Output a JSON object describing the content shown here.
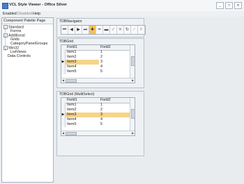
{
  "window": {
    "title": "VCL Style Viewer - Office Silver"
  },
  "menu": {
    "items": [
      {
        "label": "Enabled",
        "enabled": true
      },
      {
        "label": "Disabled",
        "enabled": false
      },
      {
        "label": "Help",
        "enabled": true
      }
    ]
  },
  "left_panel": {
    "caption": "Component Palette Page",
    "tree": [
      {
        "label": "Standard",
        "expander": "-"
      },
      {
        "label": "Forms"
      },
      {
        "label": "Additional",
        "expander": "-"
      },
      {
        "label": "Grids"
      },
      {
        "label": "CategoryPanelGroups"
      },
      {
        "label": "Win32",
        "expander": "-"
      },
      {
        "label": "ListViews"
      },
      {
        "label": "Data Controls"
      }
    ]
  },
  "navigator": {
    "caption": "TDBNavigator",
    "buttons": [
      {
        "icon": "first-record-icon",
        "glyph": "⏮"
      },
      {
        "icon": "prior-record-icon",
        "glyph": "◀"
      },
      {
        "icon": "next-record-icon",
        "glyph": "▶"
      },
      {
        "icon": "last-record-icon",
        "glyph": "⏭"
      },
      {
        "icon": "insert-icon",
        "glyph": "✚"
      },
      {
        "icon": "delete-icon",
        "glyph": "━"
      },
      {
        "icon": "edit-icon",
        "glyph": "▬"
      },
      {
        "icon": "post-icon",
        "glyph": "✔"
      },
      {
        "icon": "cancel-icon",
        "glyph": "✖"
      },
      {
        "icon": "refresh-icon",
        "glyph": "↻"
      },
      {
        "icon": "apply-updates-icon",
        "glyph": "✓"
      },
      {
        "icon": "cancel-updates-icon",
        "glyph": "✗"
      }
    ]
  },
  "grid1": {
    "caption": "TDBGrid",
    "columns": [
      "Field1",
      "Field2"
    ],
    "rows": [
      [
        "Item1",
        "1"
      ],
      [
        "Item2",
        "2"
      ],
      [
        "Item3",
        "3"
      ],
      [
        "Item4",
        "4"
      ],
      [
        "Item5",
        "5"
      ]
    ]
  },
  "grid2": {
    "caption": "TDBGrid (MultiSelect)",
    "columns": [
      "Field1",
      "Field2"
    ],
    "rows": [
      [
        "Item1",
        "1"
      ],
      [
        "Item2",
        "2"
      ],
      [
        "Item3",
        "3"
      ],
      [
        "Item4",
        "4"
      ],
      [
        "Item5",
        "5"
      ]
    ]
  },
  "colors": {
    "accent": "#f4c05a",
    "selection": "#f6d48a"
  }
}
